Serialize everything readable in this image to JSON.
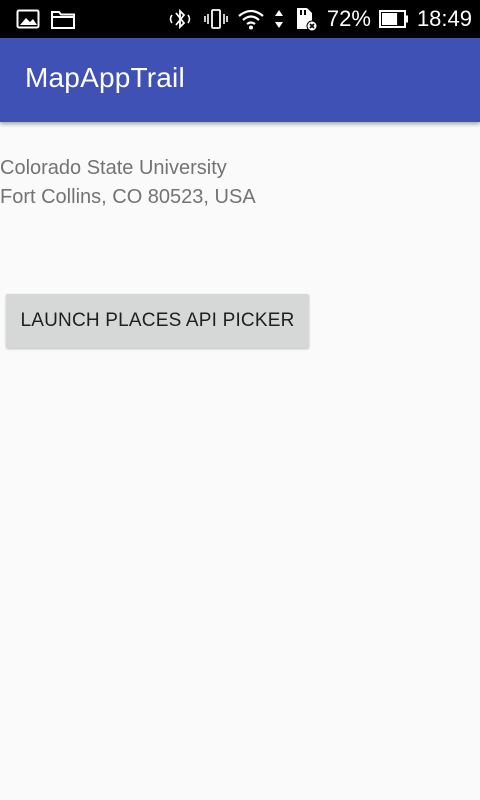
{
  "status_bar": {
    "icons_left": [
      "image-icon",
      "folder-icon"
    ],
    "icons_right": [
      "bluetooth-icon",
      "vibrate-icon",
      "wifi-icon",
      "data-transfer-icon",
      "sd-card-icon"
    ],
    "battery_percent": "72%",
    "battery_level": 0.72,
    "time": "18:49"
  },
  "app_bar": {
    "title": "MapAppTrail",
    "color": "#3f51b5"
  },
  "content": {
    "place_name": "Colorado State University",
    "place_address": "Fort Collins, CO 80523, USA"
  },
  "actions": {
    "launch_label": "LAUNCH PLACES API PICKER"
  }
}
